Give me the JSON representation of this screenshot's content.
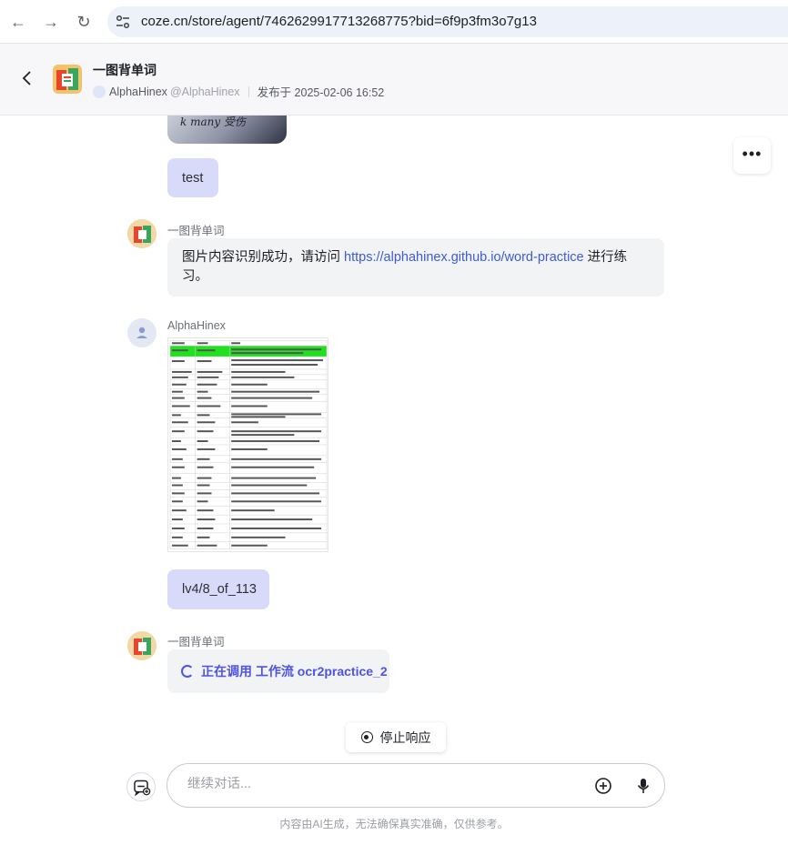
{
  "browser": {
    "url": "coze.cn/store/agent/7462629917713268775?bid=6f9p3fm3o7g13"
  },
  "header": {
    "agent_name": "一图背单词",
    "author": "AlphaHinex",
    "author_handle": "@AlphaHinex",
    "published": "发布于 2025-02-06 16:52"
  },
  "messages": {
    "user_test": "test",
    "bot_name_1": "一图背单词",
    "bot_reply_prefix": "图片内容识别成功，请访问 ",
    "bot_reply_link": "https://alphahinex.github.io/word-practice",
    "bot_reply_suffix": " 进行练习。",
    "user_name": "AlphaHinex",
    "user_level": "lv4/8_of_113",
    "bot_name_2": "一图背单词",
    "workflow_status": "正在调用 工作流 ocr2practice_2"
  },
  "controls": {
    "stop_label": "停止响应",
    "input_placeholder": "继续对话...",
    "disclaimer": "内容由AI生成，无法确保真实准确，仅供参考。"
  },
  "colors": {
    "accent": "#4d53e8",
    "user_bubble": "#d8daf9",
    "bot_bubble": "#f2f3f5",
    "link": "#3b5bdb"
  }
}
